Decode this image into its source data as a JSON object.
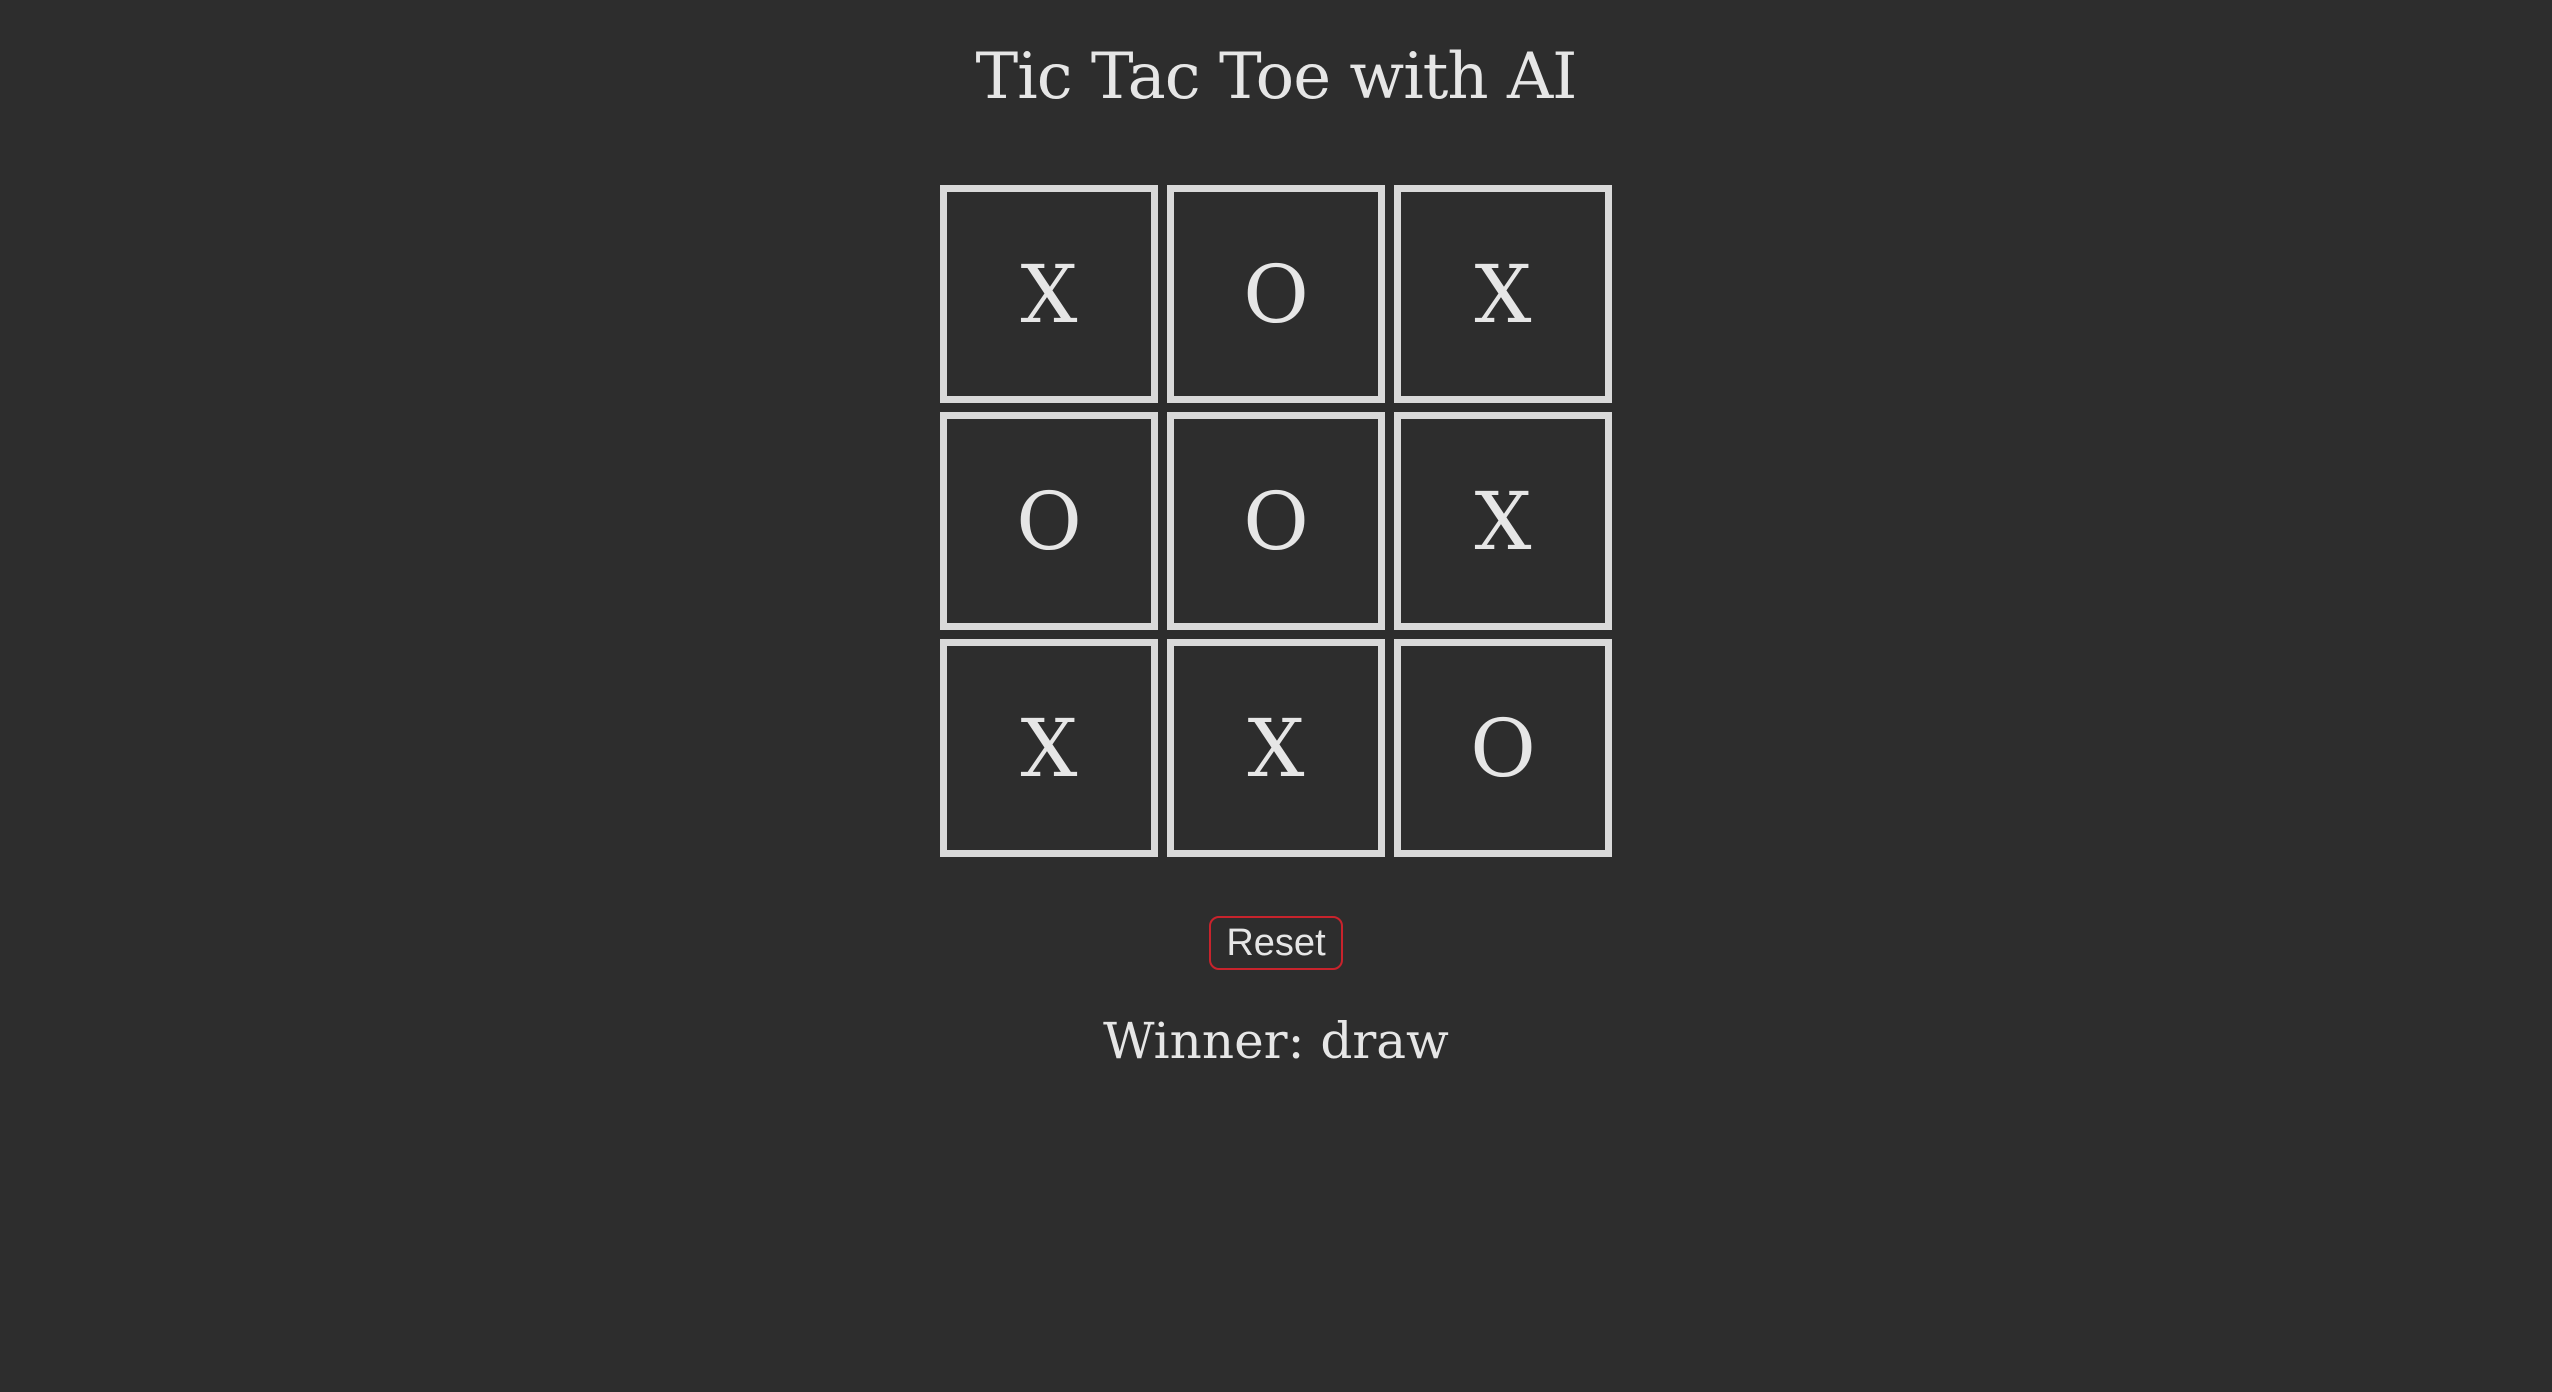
{
  "game": {
    "title": "Tic Tac Toe with AI",
    "board": [
      "X",
      "O",
      "X",
      "O",
      "O",
      "X",
      "X",
      "X",
      "O"
    ],
    "reset_label": "Reset",
    "status_prefix": "Winner: ",
    "winner": "draw"
  },
  "colors": {
    "background": "#2d2d2d",
    "text": "#e6e6e6",
    "cell_border": "#d9d9d9",
    "reset_border": "#c8232c"
  }
}
